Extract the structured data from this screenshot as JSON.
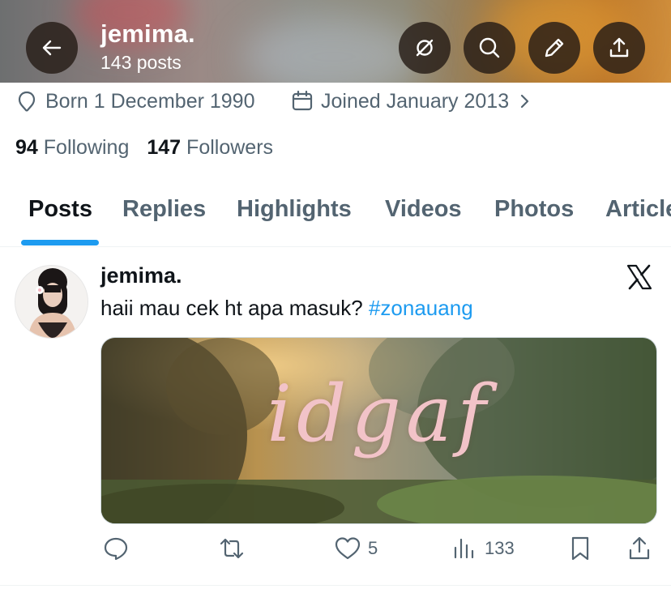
{
  "header": {
    "name": "jemima.",
    "post_count": "143 posts"
  },
  "profile": {
    "born": "Born 1 December 1990",
    "joined": "Joined January 2013",
    "following_count": "94",
    "following_label": "Following",
    "followers_count": "147",
    "followers_label": "Followers"
  },
  "tabs": [
    {
      "label": "Posts",
      "active": true
    },
    {
      "label": "Replies",
      "active": false
    },
    {
      "label": "Highlights",
      "active": false
    },
    {
      "label": "Videos",
      "active": false
    },
    {
      "label": "Photos",
      "active": false
    },
    {
      "label": "Articles",
      "active": false
    }
  ],
  "post": {
    "author": "jemima.",
    "text": "haii mau cek ht apa masuk?",
    "hashtag": "#zonauang",
    "media_text": "idgaf",
    "replies": "",
    "reposts": "",
    "likes": "5",
    "views": "133"
  },
  "colors": {
    "accent": "#1d9bf0",
    "secondary_text": "#536471",
    "primary_text": "#0f1419",
    "media_text": "#f2c3c8"
  },
  "icons": [
    "back-arrow-icon",
    "grok-icon",
    "search-icon",
    "edit-icon",
    "share-icon",
    "location-icon",
    "calendar-icon",
    "chevron-right-icon",
    "x-logo-icon",
    "reply-icon",
    "repost-icon",
    "like-icon",
    "views-icon",
    "bookmark-icon"
  ]
}
